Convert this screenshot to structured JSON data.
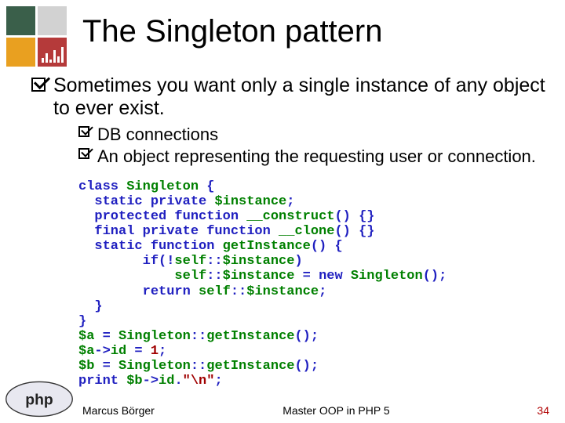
{
  "title": "The Singleton pattern",
  "point_main": "Sometimes you want only a single instance of any object to ever exist.",
  "sub1": "DB connections",
  "sub2": "An object representing the requesting user or connection.",
  "code": {
    "l1a": "class ",
    "l1b": "Singleton ",
    "l1c": "{",
    "l2a": "  static private ",
    "l2b": "$instance",
    "l2c": ";",
    "l3a": "  protected function ",
    "l3b": "__construct",
    "l3c": "() {}",
    "l4a": "  final private function ",
    "l4b": "__clone",
    "l4c": "() {}",
    "l5a": "  static function ",
    "l5b": "getInstance",
    "l5c": "() {",
    "l6a": "        if(!",
    "l6b": "self",
    "l6c": "::",
    "l6d": "$instance",
    "l6e": ")",
    "l7a": "            ",
    "l7b": "self",
    "l7c": "::",
    "l7d": "$instance ",
    "l7e": "= new ",
    "l7f": "Singleton",
    "l7g": "();",
    "l8a": "        return ",
    "l8b": "self",
    "l8c": "::",
    "l8d": "$instance",
    "l8e": ";",
    "l9a": "  }",
    "l10a": "}",
    "l11a": "$a ",
    "l11b": "= ",
    "l11c": "Singleton",
    "l11d": "::",
    "l11e": "getInstance",
    "l11f": "();",
    "l12a": "$a",
    "l12b": "->",
    "l12c": "id ",
    "l12d": "= ",
    "l12e": "1",
    "l12f": ";",
    "l13a": "$b ",
    "l13b": "= ",
    "l13c": "Singleton",
    "l13d": "::",
    "l13e": "getInstance",
    "l13f": "();",
    "l14a": "print ",
    "l14b": "$b",
    "l14c": "->",
    "l14d": "id",
    "l14e": ".",
    "l14f": "\"\\n\"",
    "l14g": ";"
  },
  "footer": {
    "author": "Marcus Börger",
    "course": "Master OOP in PHP 5",
    "slide": "34"
  }
}
